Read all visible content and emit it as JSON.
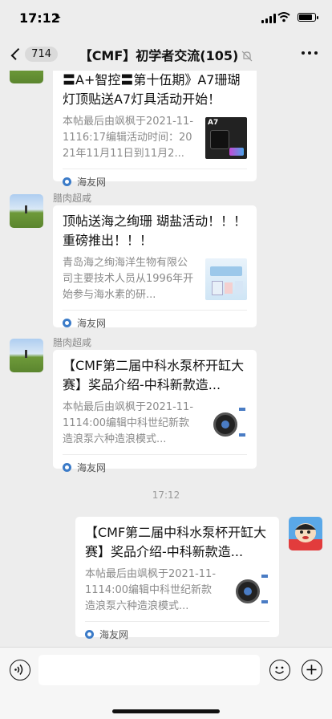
{
  "status": {
    "time": "17:12"
  },
  "nav": {
    "badge": "714",
    "title": "【CMF】初学者交流(105)"
  },
  "messages": [
    {
      "sender": "",
      "title": "〓A+智控〓第十伍期》A7珊瑚灯顶贴送A7灯具活动开始！",
      "desc": "本帖最后由飒枫于2021-11-1116:17编辑活动时间：2021年11月11日到11月2...",
      "source": "海友网",
      "thumb_label": "A7"
    },
    {
      "sender": "腊肉超咸",
      "title": "顶帖送海之绚珊 瑚盐活动！！！ 重磅推出！！！",
      "desc": "青岛海之绚海洋生物有限公司主要技术人员从1996年开始参与海水素的研...",
      "source": "海友网"
    },
    {
      "sender": "腊肉超咸",
      "title": "【CMF第二届中科水泵杯开缸大赛】奖品介绍-中科新款造...",
      "desc": "本帖最后由飒枫于2021-11-1114:00编辑中科世纪新款造浪泵六种造浪模式...",
      "source": "海友网"
    }
  ],
  "timestamp": "17:12",
  "my_message": {
    "title": "【CMF第二届中科水泵杯开缸大赛】奖品介绍-中科新款造...",
    "desc": "本帖最后由飒枫于2021-11-1114:00编辑中科世纪新款造浪泵六种造浪模式...",
    "source": "海友网"
  },
  "input": {
    "placeholder": ""
  }
}
